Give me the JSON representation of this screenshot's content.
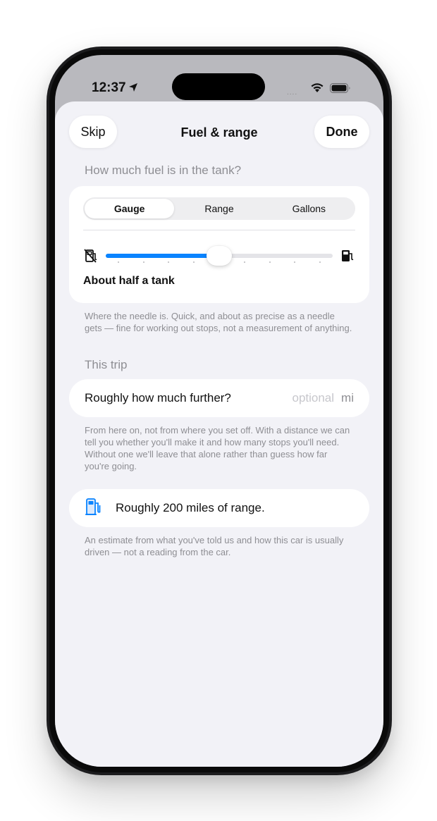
{
  "status_bar": {
    "time": "12:37",
    "signal": "....",
    "icons": [
      "location-arrow-icon",
      "wifi-icon",
      "battery-icon"
    ]
  },
  "nav": {
    "skip_label": "Skip",
    "title": "Fuel & range",
    "done_label": "Done"
  },
  "fuel": {
    "section_header": "How much fuel is in the tank?",
    "segments": [
      {
        "label": "Gauge",
        "selected": true
      },
      {
        "label": "Range",
        "selected": false
      },
      {
        "label": "Gallons",
        "selected": false
      }
    ],
    "gauge_level": 0.5,
    "tick_count": 9,
    "level_label": "About half a tank",
    "footnote": "Where the needle is. Quick, and about as precise as a needle gets — fine for working out stops, not a measurement of anything.",
    "icons": [
      "fuel-empty-icon",
      "fuel-full-icon"
    ]
  },
  "trip": {
    "section_header": "This trip",
    "distance_label": "Roughly how much further?",
    "distance_placeholder": "optional",
    "distance_unit": "mi",
    "footnote": "From here on, not from where you set off. With a distance we can tell you whether you'll make it and how many stops you'll need. Without one we'll leave that alone rather than guess how far you're going."
  },
  "range_estimate": {
    "text": "Roughly 200 miles of range.",
    "icon": "fuel-pump-icon",
    "footnote": "An estimate from what you've told us and how this car is usually driven — not a reading from the car."
  },
  "colors": {
    "accent": "#0a84ff",
    "sheet_background": "#f2f2f7",
    "secondary_text": "#8e8e93"
  }
}
